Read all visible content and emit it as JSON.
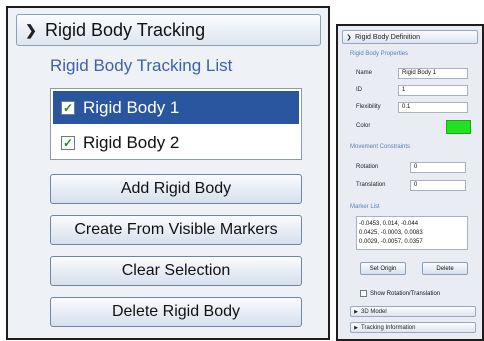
{
  "left": {
    "header_title": "Rigid Body Tracking",
    "list_title": "Rigid Body Tracking List",
    "items": [
      {
        "label": "Rigid Body 1",
        "checked": true,
        "selected": true
      },
      {
        "label": "Rigid Body 2",
        "checked": true,
        "selected": false
      }
    ],
    "buttons": {
      "add": "Add Rigid Body",
      "create_visible": "Create From Visible Markers",
      "clear_selection": "Clear Selection",
      "delete": "Delete Rigid Body"
    }
  },
  "right": {
    "header_title": "Rigid Body Definition",
    "properties_section": "Rigid Body Properties",
    "name_label": "Name",
    "name_value": "Rigid Body 1",
    "id_label": "ID",
    "id_value": "1",
    "flexibility_label": "Flexibility",
    "flexibility_value": "0.1",
    "color_label": "Color",
    "color_value": "#22e022",
    "constraints_section": "Movement Constraints",
    "rotation_label": "Rotation",
    "rotation_value": "0",
    "translation_label": "Translation",
    "translation_value": "0",
    "marker_section": "Marker List",
    "markers": [
      "-0.0453, 0.014, -0.044",
      "0.0425, -0.0003, 0.0083",
      "0.0029, -0.0057, 0.0357"
    ],
    "set_origin": "Set Origin",
    "delete": "Delete",
    "show_rotation": "Show Rotation/Translation",
    "model_3d": "3D Model",
    "tracking_info": "Tracking Information"
  }
}
